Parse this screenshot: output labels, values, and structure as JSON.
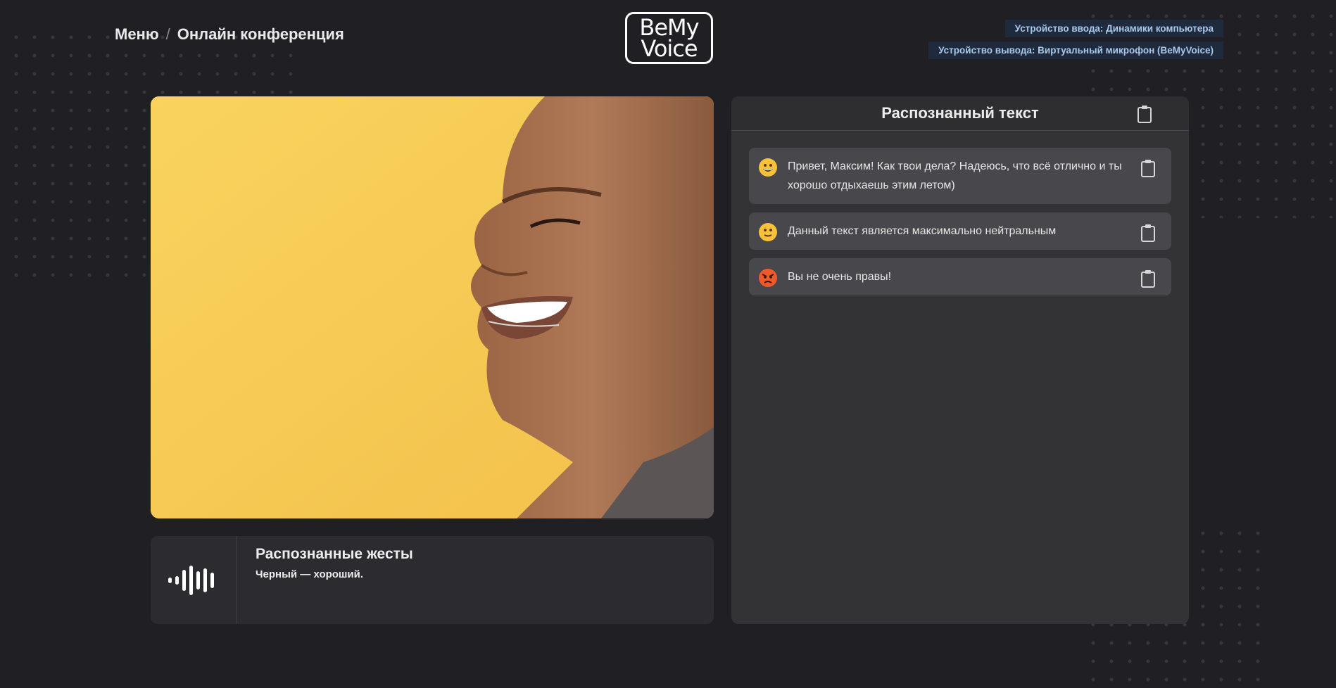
{
  "breadcrumb": {
    "menu": "Меню",
    "separator": "/",
    "current": "Онлайн конференция"
  },
  "logo": {
    "line1": "BeMy",
    "line2": "Voice"
  },
  "devices": {
    "input": "Устройство ввода: Динамики компьютера",
    "output": "Устройство вывода: Виртуальный микрофон (BeMyVoice)"
  },
  "gestures": {
    "title": "Распознанные жесты",
    "text": "Черный — хороший."
  },
  "recognized": {
    "title": "Распознанный текст",
    "messages": [
      {
        "emoji": "grinning-face-icon",
        "text": "Привет, Максим! Как твои дела? Надеюсь, что всё отлично и ты хорошо отдыхаешь этим летом)"
      },
      {
        "emoji": "slight-smile-face-icon",
        "text": "Данный текст является максимально нейтральным"
      },
      {
        "emoji": "angry-face-icon",
        "text": "Вы не очень правы!"
      }
    ]
  },
  "colors": {
    "background": "#202024",
    "panel": "#333336",
    "message": "#48484c",
    "badge": "#1f2b3c",
    "badge_text": "#a9c9ec",
    "video_bg": "#f5c855"
  }
}
